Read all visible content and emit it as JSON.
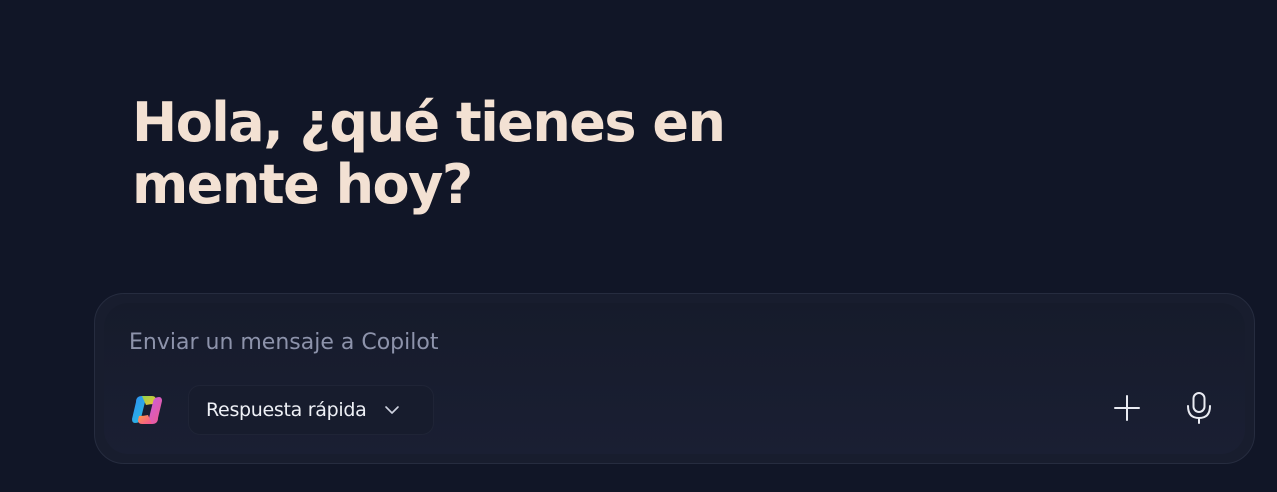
{
  "greeting": {
    "text": "Hola, ¿qué tienes en mente hoy?"
  },
  "composer": {
    "placeholder": "Enviar un mensaje a Copilot",
    "value": "",
    "logo_icon": "copilot-logo-icon",
    "mode": {
      "label": "Respuesta rápida",
      "icon": "chevron-down-icon"
    },
    "add_icon": "plus-icon",
    "mic_icon": "microphone-icon"
  },
  "colors": {
    "background": "#111627",
    "greeting_text": "#f3e1d3",
    "composer_bg": "#181d2e",
    "placeholder": "#8d93ab"
  }
}
